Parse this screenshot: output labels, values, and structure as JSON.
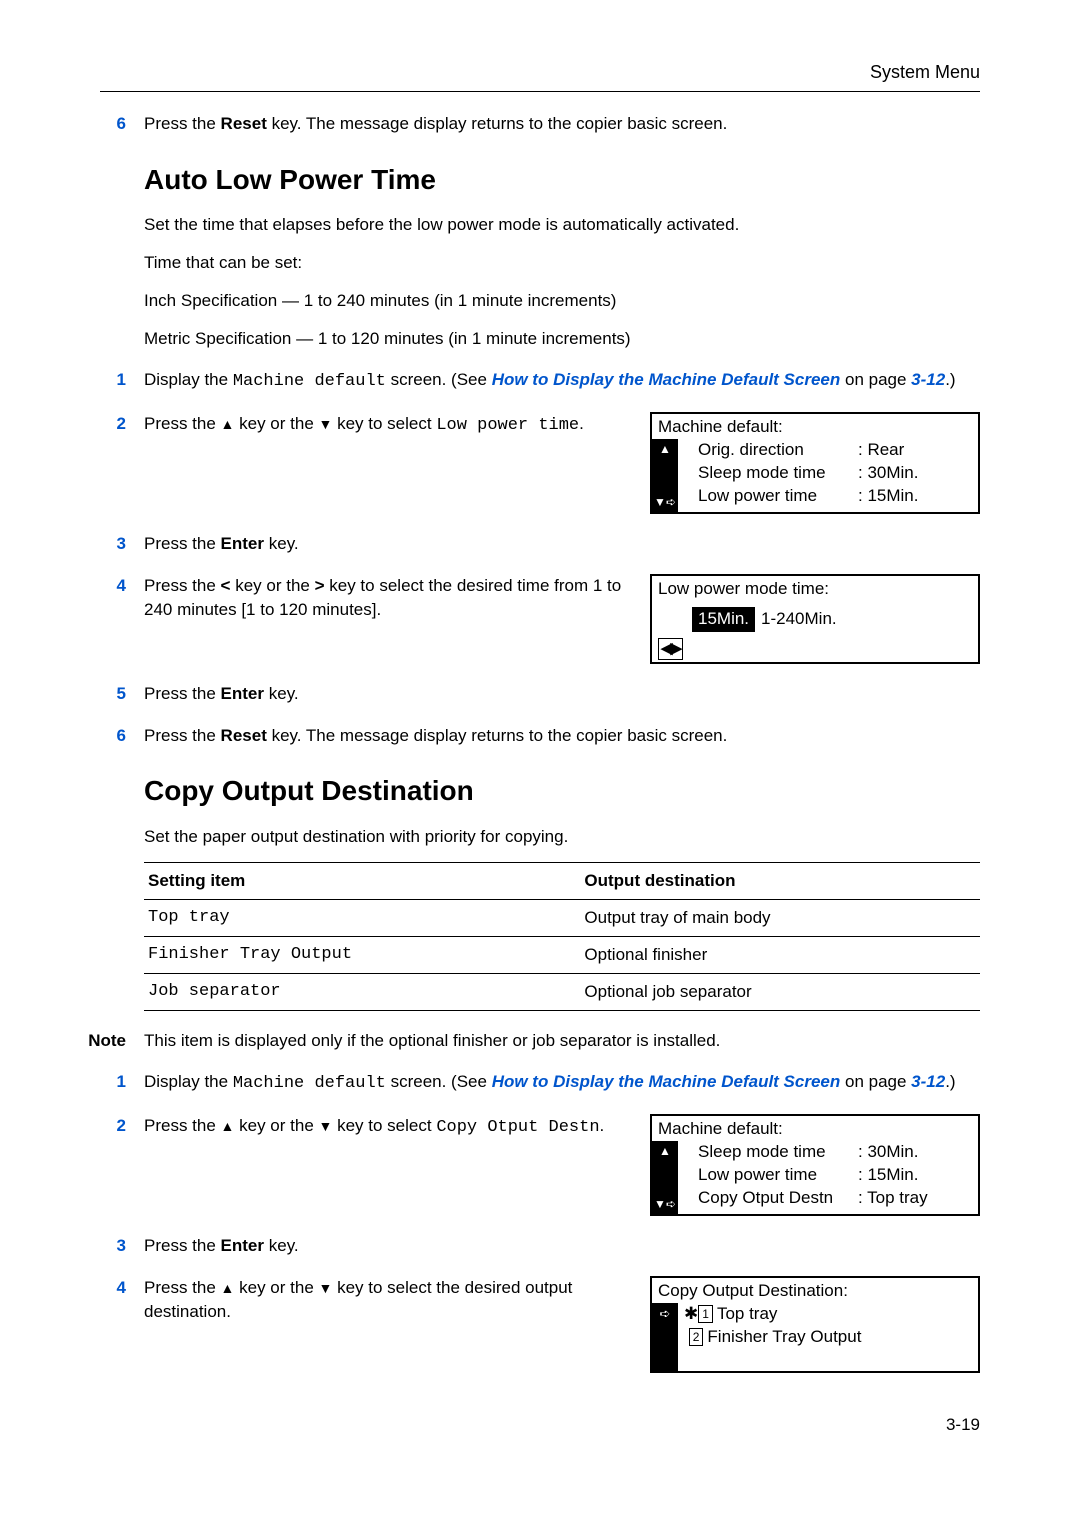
{
  "header": {
    "section": "System Menu"
  },
  "step6a": {
    "prefix": "Press the ",
    "key": "Reset",
    "suffix": " key. The message display returns to the copier basic screen."
  },
  "autoLowPower": {
    "heading": "Auto Low Power Time",
    "p1": "Set the time that elapses before the low power mode is automatically activated.",
    "p2": "Time that can be set:",
    "p3": "Inch Specification — 1 to 240 minutes (in 1 minute increments)",
    "p4": "Metric Specification — 1 to 120 minutes (in 1 minute increments)"
  },
  "step1a": {
    "prefix": "Display the ",
    "mono": "Machine default",
    "mid": " screen. (See ",
    "link": "How to Display the Machine Default Screen",
    "mid2": " on page ",
    "pageref": "3-12",
    "suffix": ".)"
  },
  "step2a": {
    "prefix": "Press the ",
    "keyup": "▲",
    "mid1": " key or the ",
    "keydown": "▼",
    "mid2": " key to select ",
    "mono": "Low power time",
    "suffix": "."
  },
  "lcd1": {
    "title": "Machine default:",
    "row1": {
      "label": "Orig. direction",
      "value": ": Rear"
    },
    "row2": {
      "label": "Sleep mode time",
      "value": ": 30Min."
    },
    "row3": {
      "label": "Low power time",
      "value": ": 15Min."
    }
  },
  "step3a": {
    "prefix": "Press the ",
    "key": "Enter",
    "suffix": " key."
  },
  "step4a": {
    "prefix": "Press the ",
    "k1": "<",
    "mid1": " key or the ",
    "k2": ">",
    "mid2": " key to select the desired time from 1 to 240 minutes [1 to 120 minutes]."
  },
  "lcd2": {
    "title": "Low power mode time:",
    "highlight": "15Min.",
    "range": "1-240Min."
  },
  "step5a": {
    "prefix": "Press the ",
    "key": "Enter",
    "suffix": " key."
  },
  "step6b": {
    "prefix": "Press the ",
    "key": "Reset",
    "suffix": " key. The message display returns to the copier basic screen."
  },
  "copyOutput": {
    "heading": "Copy Output Destination",
    "p1": "Set the paper output destination with priority for copying.",
    "th1": "Setting item",
    "th2": "Output destination",
    "rows": [
      {
        "item": "Top tray",
        "dest": "Output tray of main body"
      },
      {
        "item": "Finisher Tray Output",
        "dest": "Optional finisher"
      },
      {
        "item": "Job separator",
        "dest": "Optional job separator"
      }
    ]
  },
  "note": {
    "label": "Note",
    "text": "This item is displayed only if the optional finisher or job separator is installed."
  },
  "step1b": {
    "prefix": "Display the ",
    "mono": "Machine default",
    "mid": " screen. (See ",
    "link": "How to Display the Machine Default Screen",
    "mid2": " on page ",
    "pageref": "3-12",
    "suffix": ".)"
  },
  "step2b": {
    "prefix": "Press the ",
    "keyup": "▲",
    "mid1": " key or the ",
    "keydown": "▼",
    "mid2": " key to select ",
    "mono": "Copy Otput Destn",
    "suffix": "."
  },
  "lcd3": {
    "title": "Machine default:",
    "row1": {
      "label": "Sleep mode time",
      "value": ": 30Min."
    },
    "row2": {
      "label": "Low power time",
      "value": ": 15Min."
    },
    "row3": {
      "label": "Copy Otput Destn",
      "value": ": Top tray"
    }
  },
  "step3b": {
    "prefix": "Press the ",
    "key": "Enter",
    "suffix": " key."
  },
  "step4b": {
    "prefix": "Press the ",
    "keyup": "▲",
    "mid1": " key or the ",
    "keydown": "▼",
    "mid2": " key to select the desired output destination."
  },
  "lcd4": {
    "title": "Copy Output Destination:",
    "opt1": "Top tray",
    "opt2": "Finisher Tray Output"
  },
  "pageNumber": "3-19",
  "nums": {
    "n1": "1",
    "n2": "2",
    "n3": "3",
    "n4": "4",
    "n5": "5",
    "n6": "6"
  }
}
